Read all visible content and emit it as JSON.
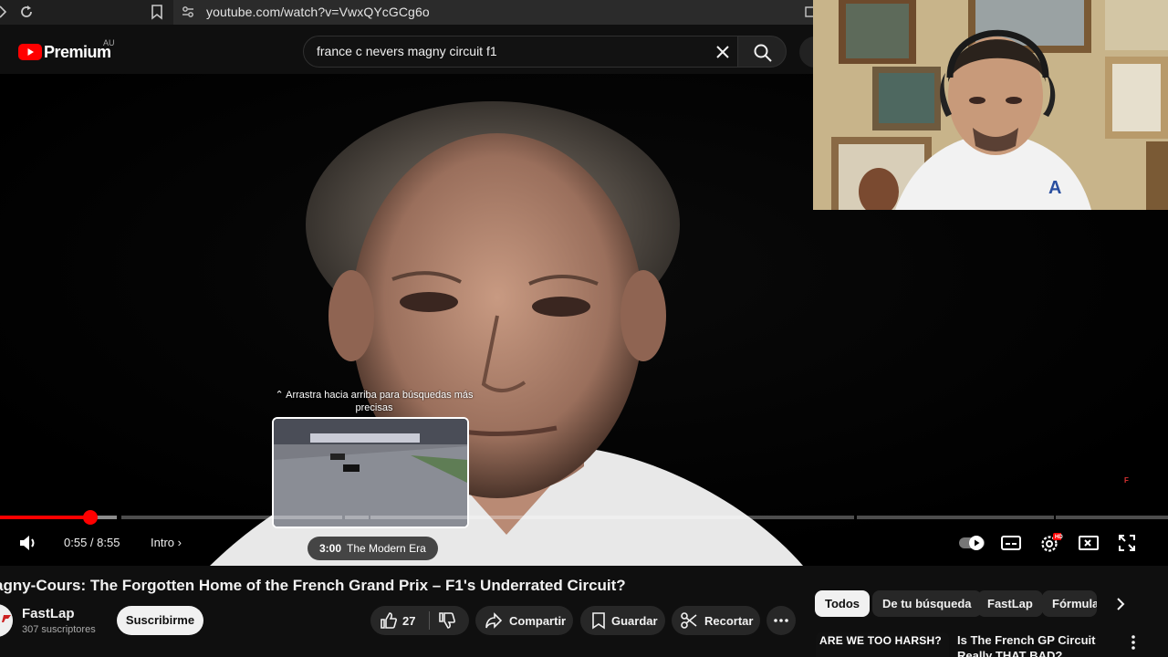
{
  "browser": {
    "url": "youtube.com/watch?v=VwxQYcGCg6o"
  },
  "header": {
    "logo_text": "Premium",
    "logo_country": "AU",
    "search_value": "france c nevers magny circuit f1"
  },
  "player": {
    "drag_hint": "Arrastra hacia arriba para búsquedas más precisas",
    "preview_time": "3:00",
    "preview_chapter": "The Modern Era",
    "current_time": "0:55",
    "duration": "8:55",
    "time_separator": " / ",
    "chapter": "Intro",
    "watermark": "FASTLAP",
    "settings_badge": "HD",
    "progress_played_fraction": 0.103,
    "autoplay": true
  },
  "video": {
    "title": "agny-Cours: The Forgotten Home of the French Grand Prix – F1's Underrated Circuit?"
  },
  "channel": {
    "name": "FastLap",
    "subscribers": "307 suscriptores",
    "subscribe_label": "Suscribirme"
  },
  "actions": {
    "likes": "27",
    "share": "Compartir",
    "save": "Guardar",
    "clip": "Recortar"
  },
  "chips": [
    "Todos",
    "De tu búsqueda",
    "FastLap",
    "Fórmula"
  ],
  "related": [
    {
      "thumb_text": "ARE WE TOO HARSH?",
      "title": "Is The French GP Circuit Really THAT BAD?"
    }
  ],
  "colors": {
    "accent": "#ff0000",
    "background": "#0f0f0f",
    "chip_active": "#f1f1f1"
  }
}
